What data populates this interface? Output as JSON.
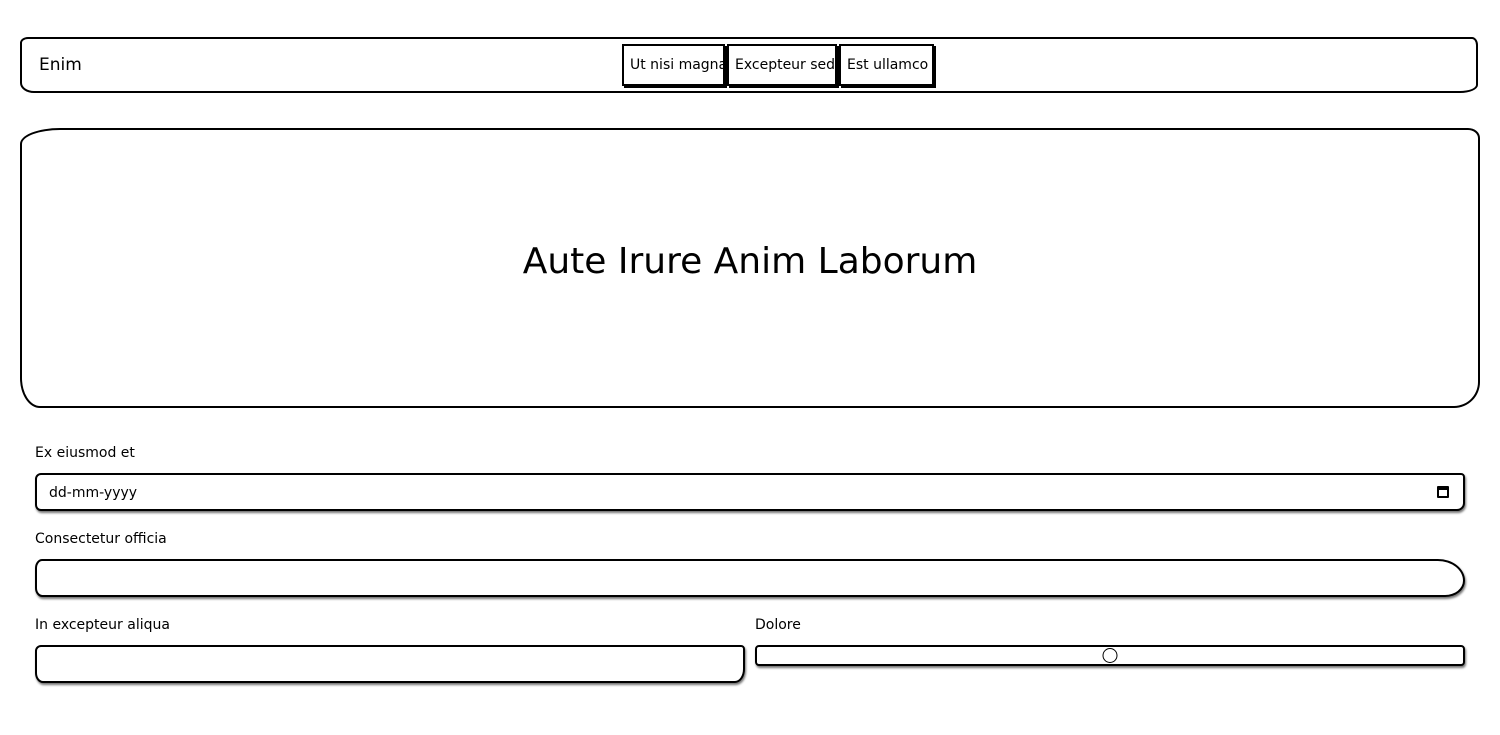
{
  "navbar": {
    "brand": "Enim",
    "links": [
      "Ut nisi magna",
      "Excepteur sed",
      "Est ullamco"
    ]
  },
  "hero": {
    "title": "Aute Irure Anim Laborum"
  },
  "form": {
    "date_label": "Ex eiusmod et",
    "date_placeholder": "dd-mm-yyyy",
    "text1_label": "Consectetur officia",
    "text1_value": "",
    "text2_label": "In excepteur aliqua",
    "text2_value": "",
    "range_label": "Dolore",
    "range_value_fraction": 0.5
  }
}
